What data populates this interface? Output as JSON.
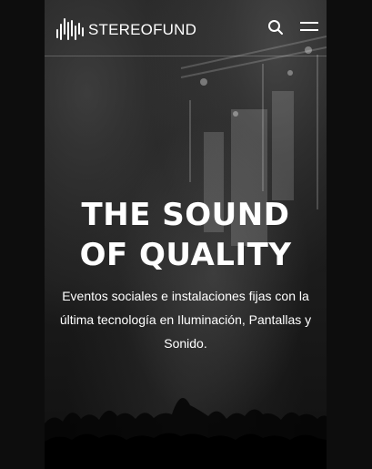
{
  "header": {
    "brand": "STEREOFUND",
    "search_icon": "search-icon",
    "menu_icon": "hamburger-menu-icon"
  },
  "hero": {
    "title_line1": "THE SOUND",
    "title_line2": "OF QUALITY",
    "description": "Eventos sociales e instalaciones fijas con la última tecnología en Iluminación, Pantallas y Sonido."
  },
  "colors": {
    "page_background": "#0d0d0d",
    "text": "#ffffff"
  }
}
